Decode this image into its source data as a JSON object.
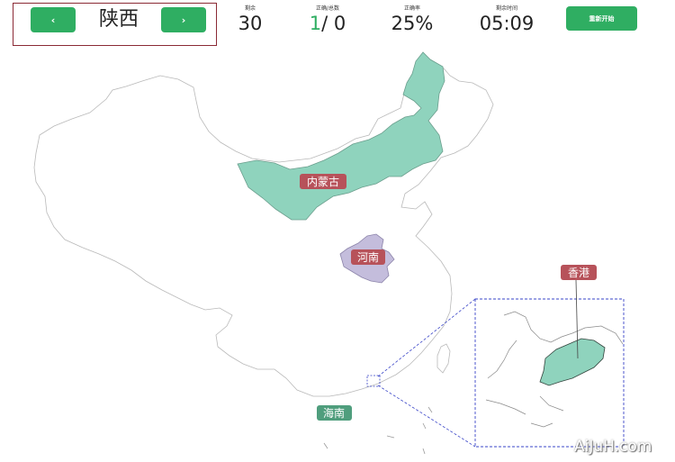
{
  "header": {
    "prev_label": "‹",
    "next_label": "›",
    "current_province": "陕西"
  },
  "stats": {
    "remaining_label": "剩余",
    "remaining_value": "30",
    "correct_total_label": "正确/总数",
    "correct_value": "1",
    "total_value": "/ 0",
    "accuracy_label": "正确率",
    "accuracy_value": "25%",
    "time_label": "剩余时间",
    "time_value": "05:09"
  },
  "restart_label": "重新开始",
  "map": {
    "labels": {
      "inner_mongolia": "内蒙古",
      "henan": "河南",
      "hongkong": "香港",
      "hainan": "海南"
    },
    "colors": {
      "correct_fill": "#8fd3bd",
      "selected_fill": "#c4bddc",
      "label_red": "#b7525a",
      "label_green": "#4f9e7d",
      "inset_border": "#3a45c8"
    }
  },
  "watermark": "AiJuH.com"
}
